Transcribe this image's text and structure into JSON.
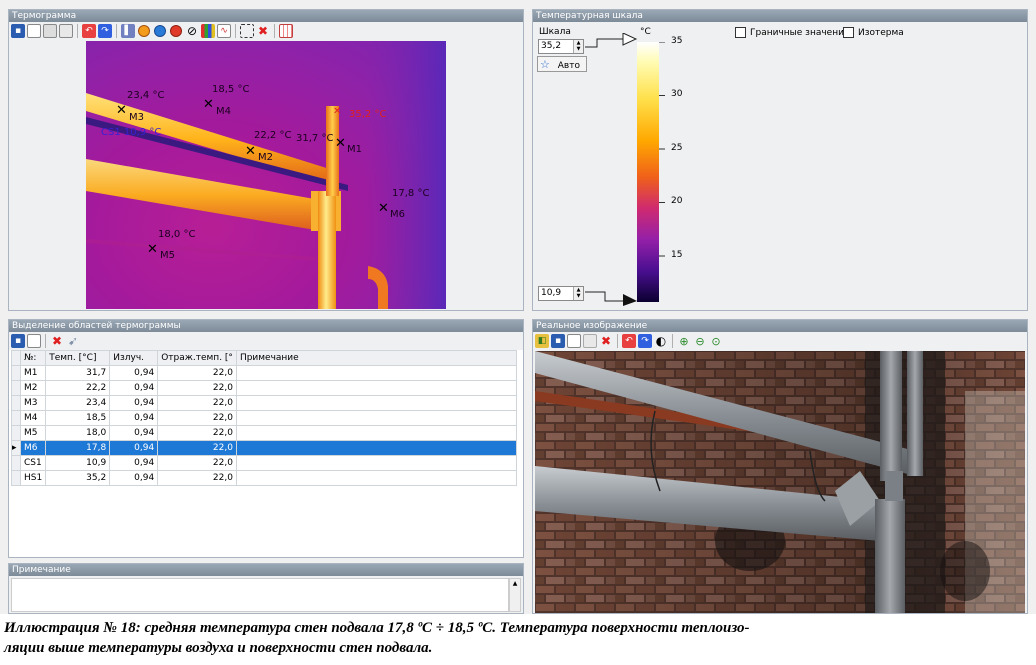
{
  "thermogram": {
    "title": "Термограмма",
    "labels": {
      "m3": "23,4 °C",
      "m4": "18,5 °C",
      "m2": "22,2 °C",
      "m1": "31,7 °C",
      "hs1": "35,2 °C",
      "cs1": "CS1 10,9 °C",
      "m6": "17,8 °C",
      "m5": "18,0 °C"
    },
    "markers": {
      "m1": "M1",
      "m2": "M2",
      "m3": "M3",
      "m4": "M4",
      "m5": "M5",
      "m6": "M6"
    }
  },
  "scale": {
    "title": "Температурная шкала",
    "scale_label": "Шкала",
    "max_value": "35,2",
    "min_value": "10,9",
    "auto_label": "Авто",
    "unit": "°C",
    "ticks": [
      "35",
      "30",
      "25",
      "20",
      "15"
    ],
    "boundary_label": "Граничные значения",
    "isotherm_label": "Изотерма"
  },
  "regions": {
    "title": "Выделение областей термограммы",
    "columns": [
      "№:",
      "Темп. [°C]",
      "Излуч.",
      "Отраж.темп. [°",
      "Примечание"
    ],
    "rows": [
      {
        "id": "M1",
        "temp": "31,7",
        "emis": "0,94",
        "refl": "22,0",
        "note": ""
      },
      {
        "id": "M2",
        "temp": "22,2",
        "emis": "0,94",
        "refl": "22,0",
        "note": ""
      },
      {
        "id": "M3",
        "temp": "23,4",
        "emis": "0,94",
        "refl": "22,0",
        "note": ""
      },
      {
        "id": "M4",
        "temp": "18,5",
        "emis": "0,94",
        "refl": "22,0",
        "note": ""
      },
      {
        "id": "M5",
        "temp": "18,0",
        "emis": "0,94",
        "refl": "22,0",
        "note": ""
      },
      {
        "id": "M6",
        "temp": "17,8",
        "emis": "0,94",
        "refl": "22,0",
        "note": ""
      },
      {
        "id": "CS1",
        "temp": "10,9",
        "emis": "0,94",
        "refl": "22,0",
        "note": ""
      },
      {
        "id": "HS1",
        "temp": "35,2",
        "emis": "0,94",
        "refl": "22,0",
        "note": ""
      }
    ],
    "selected_row": 5
  },
  "note_panel": {
    "title": "Примечание"
  },
  "real_image": {
    "title": "Реальное изображение"
  },
  "caption": {
    "line1": "Иллюстрация № 18: средняя температура стен подвала 17,8 ºС ÷ 18,5 ºС. Температура поверхности теплоизо-",
    "line2": "ляции выше температуры воздуха и поверхности стен подвала."
  },
  "colors": {
    "selection": "#1e78d6",
    "panel_header": "#8a97a5",
    "palette": [
      "#ffffff",
      "#fff16a",
      "#ffb400",
      "#f06a10",
      "#d0267a",
      "#8a1fb0",
      "#3a0a8a",
      "#0a0020"
    ]
  }
}
